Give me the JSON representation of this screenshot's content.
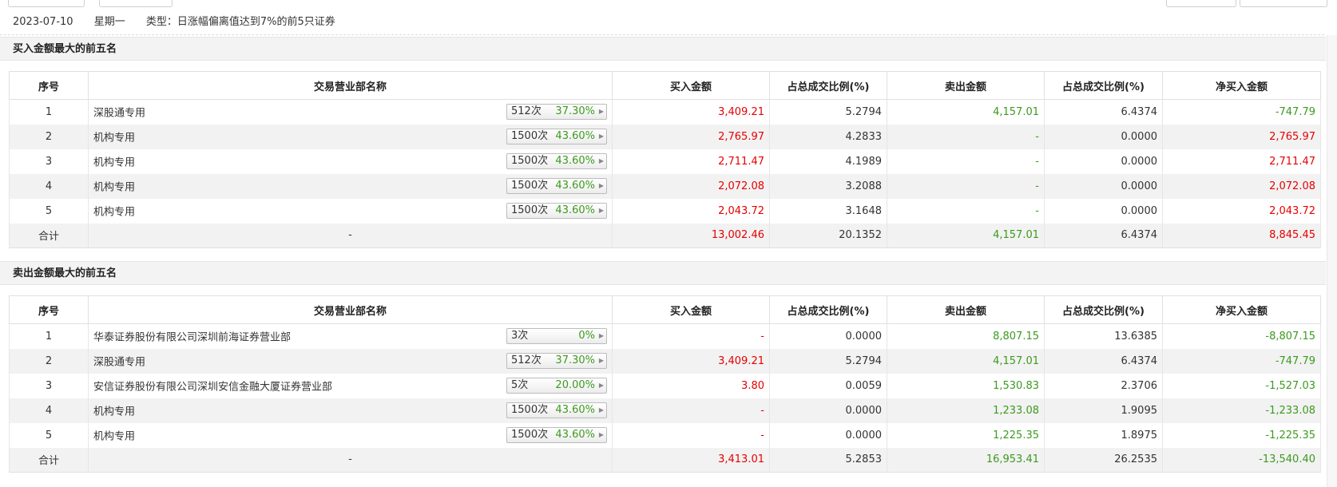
{
  "info": {
    "date": "2023-07-10",
    "weekday": "星期一",
    "type_label": "类型：日涨幅偏离值达到7%的前5只证券"
  },
  "columns": [
    "序号",
    "交易营业部名称",
    "买入金额",
    "占总成交比例(%)",
    "卖出金额",
    "占总成交比例(%)",
    "净买入金额"
  ],
  "buy_section": {
    "title": "买入金额最大的前五名",
    "rows": [
      {
        "seq": "1",
        "name": "深股通专用",
        "count": "512次",
        "pct": "37.30%",
        "buy": "3,409.21",
        "buy_ratio": "5.2794",
        "sell": "4,157.01",
        "sell_ratio": "6.4374",
        "net": "-747.79"
      },
      {
        "seq": "2",
        "name": "机构专用",
        "count": "1500次",
        "pct": "43.60%",
        "buy": "2,765.97",
        "buy_ratio": "4.2833",
        "sell": "-",
        "sell_ratio": "0.0000",
        "net": "2,765.97"
      },
      {
        "seq": "3",
        "name": "机构专用",
        "count": "1500次",
        "pct": "43.60%",
        "buy": "2,711.47",
        "buy_ratio": "4.1989",
        "sell": "-",
        "sell_ratio": "0.0000",
        "net": "2,711.47"
      },
      {
        "seq": "4",
        "name": "机构专用",
        "count": "1500次",
        "pct": "43.60%",
        "buy": "2,072.08",
        "buy_ratio": "3.2088",
        "sell": "-",
        "sell_ratio": "0.0000",
        "net": "2,072.08"
      },
      {
        "seq": "5",
        "name": "机构专用",
        "count": "1500次",
        "pct": "43.60%",
        "buy": "2,043.72",
        "buy_ratio": "3.1648",
        "sell": "-",
        "sell_ratio": "0.0000",
        "net": "2,043.72"
      }
    ],
    "total": {
      "label": "合计",
      "name": "-",
      "buy": "13,002.46",
      "buy_ratio": "20.1352",
      "sell": "4,157.01",
      "sell_ratio": "6.4374",
      "net": "8,845.45"
    }
  },
  "sell_section": {
    "title": "卖出金额最大的前五名",
    "rows": [
      {
        "seq": "1",
        "name": "华泰证券股份有限公司深圳前海证券营业部",
        "count": "3次",
        "pct": "0%",
        "buy": "-",
        "buy_ratio": "0.0000",
        "sell": "8,807.15",
        "sell_ratio": "13.6385",
        "net": "-8,807.15"
      },
      {
        "seq": "2",
        "name": "深股通专用",
        "count": "512次",
        "pct": "37.30%",
        "buy": "3,409.21",
        "buy_ratio": "5.2794",
        "sell": "4,157.01",
        "sell_ratio": "6.4374",
        "net": "-747.79"
      },
      {
        "seq": "3",
        "name": "安信证券股份有限公司深圳安信金融大厦证券营业部",
        "count": "5次",
        "pct": "20.00%",
        "buy": "3.80",
        "buy_ratio": "0.0059",
        "sell": "1,530.83",
        "sell_ratio": "2.3706",
        "net": "-1,527.03"
      },
      {
        "seq": "4",
        "name": "机构专用",
        "count": "1500次",
        "pct": "43.60%",
        "buy": "-",
        "buy_ratio": "0.0000",
        "sell": "1,233.08",
        "sell_ratio": "1.9095",
        "net": "-1,233.08"
      },
      {
        "seq": "5",
        "name": "机构专用",
        "count": "1500次",
        "pct": "43.60%",
        "buy": "-",
        "buy_ratio": "0.0000",
        "sell": "1,225.35",
        "sell_ratio": "1.8975",
        "net": "-1,225.35"
      }
    ],
    "total": {
      "label": "合计",
      "name": "-",
      "buy": "3,413.01",
      "buy_ratio": "5.2853",
      "sell": "16,953.41",
      "sell_ratio": "26.2535",
      "net": "-13,540.40"
    }
  },
  "colors": {
    "positive": "#e60000",
    "negative": "#3c9a1e"
  },
  "icons": {
    "stat_arrow": "caret-right-icon"
  }
}
